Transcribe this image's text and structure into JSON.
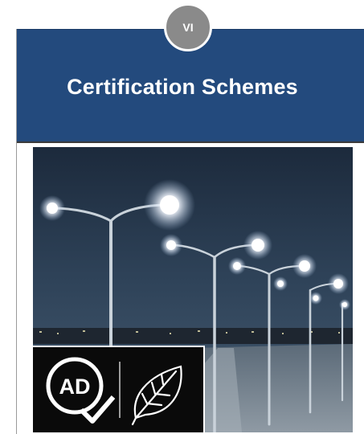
{
  "badge": {
    "label": "VI"
  },
  "header": {
    "title": "Certification Schemes"
  },
  "colors": {
    "header_bg": "#234a7d",
    "badge_bg": "#8a8a8a",
    "logo_bg": "#0a0a0a"
  },
  "photo": {
    "subject-icons": [
      "street-lamp-icon",
      "night-sky-icon",
      "road-icon"
    ]
  },
  "logo": {
    "icons": [
      "ad-quality-mark-icon",
      "leaf-icon"
    ]
  }
}
